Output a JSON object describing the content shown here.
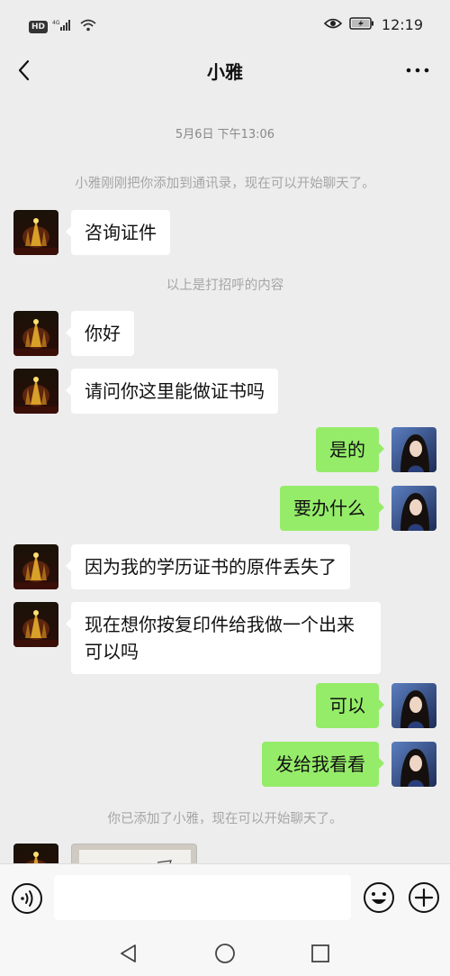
{
  "status_bar": {
    "badge": "HD",
    "network": "4G",
    "time": "12:19"
  },
  "header": {
    "title": "小雅"
  },
  "chat": {
    "timestamp": "5月6日 下午13:06",
    "system_added": "小雅刚刚把你添加到通讯录，现在可以开始聊天了。",
    "system_greeting": "以上是打招呼的内容",
    "system_added_you": "你已添加了小雅，现在可以开始聊天了。",
    "messages": [
      {
        "side": "left",
        "text": "咨询证件"
      },
      {
        "side": "left",
        "text": "你好"
      },
      {
        "side": "left",
        "text": "请问你这里能做证书吗"
      },
      {
        "side": "right",
        "text": "是的"
      },
      {
        "side": "right",
        "text": "要办什么"
      },
      {
        "side": "left",
        "text": "因为我的学历证书的原件丢失了"
      },
      {
        "side": "left",
        "text": "现在想你按复印件给我做一个出来可以吗"
      },
      {
        "side": "right",
        "text": "可以"
      },
      {
        "side": "right",
        "text": "发给我看看"
      }
    ]
  },
  "input": {
    "placeholder": ""
  },
  "icons": {
    "back": "back-arrow-icon",
    "more": "more-dots-icon",
    "voice": "voice-icon",
    "emoji": "emoji-icon",
    "plus": "plus-icon",
    "nav_back": "nav-back-icon",
    "nav_home": "nav-home-icon",
    "nav_recent": "nav-recent-icon"
  },
  "colors": {
    "background": "#ededed",
    "sent_bubble": "#95ec69",
    "received_bubble": "#ffffff"
  }
}
